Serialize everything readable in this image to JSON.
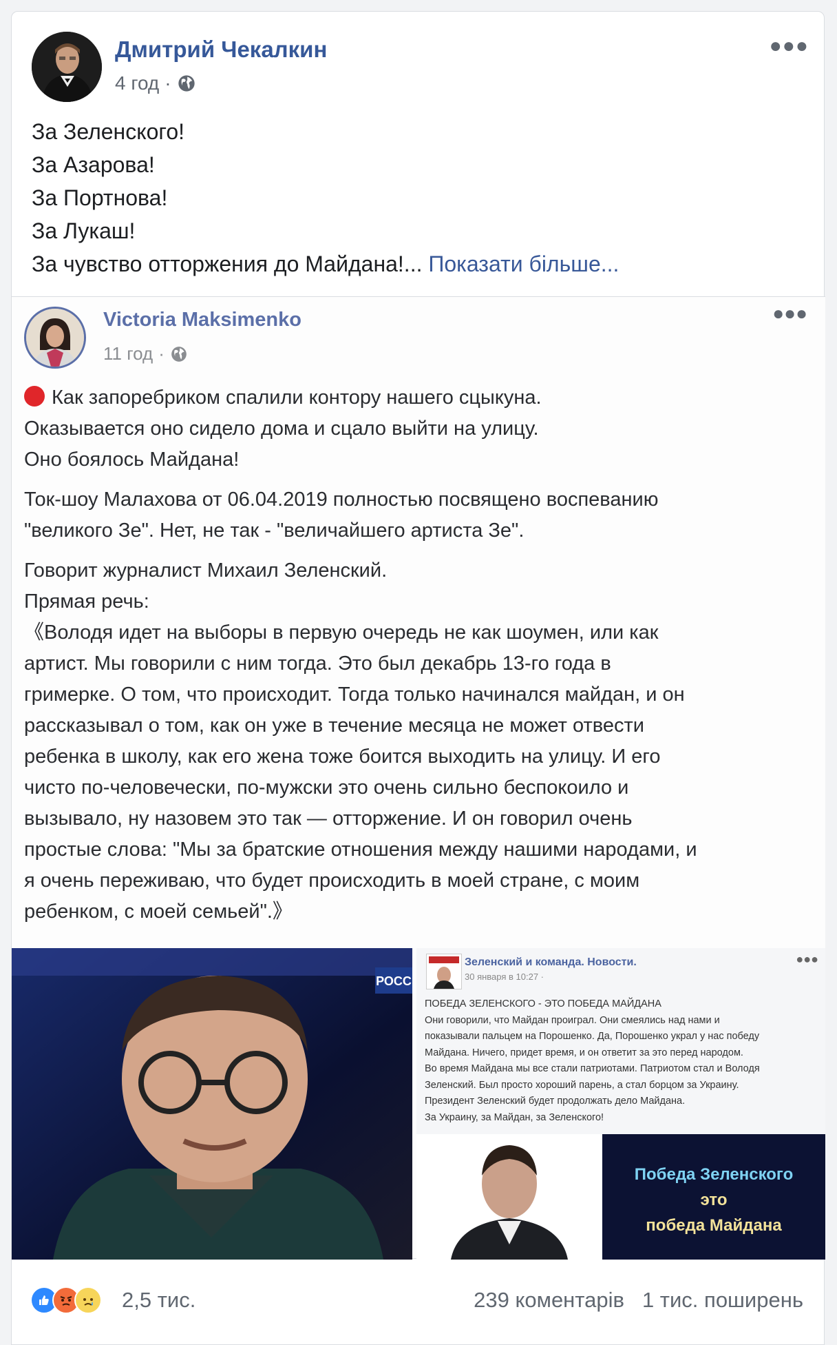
{
  "post": {
    "author": "Дмитрий Чекалкин",
    "time": "4 год",
    "separator": "·",
    "lines": [
      "За Зеленского!",
      "За Азарова!",
      "За Портнова!",
      "За Лукаш!",
      "За чувство отторжения до Майдана!..."
    ],
    "see_more": "Показати більше..."
  },
  "shared": {
    "author": "Victoria Maksimenko",
    "time": "11 год",
    "separator": "·",
    "p1": [
      "Как запоребриком спалили контору нашего сцыкуна.",
      "Оказывается оно сидело дома и сцало выйти на улицу.",
      "Оно боялось Майдана!"
    ],
    "p2": [
      "Ток-шоу Малахова от 06.04.2019 полностью посвящено воспеванию",
      "\"великого Зе\". Нет, не так - \"величайшего артиста Зе\"."
    ],
    "p3": [
      "Говорит журналист Михаил Зеленский.",
      "Прямая речь:",
      "《Володя идет на выборы в первую очередь не как шоумен, или как",
      "артист. Мы говорили с ним тогда. Это был декабрь 13-го года в",
      "гримерке. О том, что происходит. Тогда только начинался майдан, и он",
      "рассказывал о том, как он уже в течение месяца не может отвести",
      "ребенка в школу, как его жена тоже боится выходить на улицу. И его",
      "чисто по-человечески, по-мужски это очень сильно беспокоило и",
      "вызывало, ну назовем это так — отторжение. И он говорил очень",
      "простые слова: \"Мы за братские отношения между нашими народами, и",
      "я очень переживаю, что будет происходить в моей стране, с моим",
      "ребенком, с моей семьей\".》"
    ],
    "image_left": {
      "tv_logo": "РОСС"
    },
    "image_right": {
      "page_name": "Зеленский и команда. Новости.",
      "date": "30 января в 10:27 ·",
      "lines": [
        "ПОБЕДА ЗЕЛЕНСКОГО - ЭТО ПОБЕДА МАЙДАНА",
        "Они говорили, что Майдан проиграл. Они смеялись над нами и",
        "показывали пальцем на Порошенко. Да, Порошенко украл у нас победу",
        "Майдана. Ничего, придет время, и он ответит за это перед народом.",
        "Во время Майдана мы все стали патриотами. Патриотом стал и Володя",
        "Зеленский. Был просто хороший парень, а стал борцом за Украину.",
        "Президент Зеленский будет продолжать дело Майдана.",
        "За Украину, за Майдан, за Зеленского!"
      ],
      "banner": [
        "Победа Зеленского",
        "это",
        "победа Майдана"
      ]
    }
  },
  "footer": {
    "reactions_count": "2,5 тис.",
    "comments": "239 коментарів",
    "shares": "1 тис. поширень"
  },
  "colors": {
    "link": "#365899",
    "muted": "#606770",
    "like_blue": "#2e89ff"
  },
  "icons": [
    "globe-icon",
    "more-icon",
    "like-reaction-icon",
    "angry-reaction-icon",
    "sad-reaction-icon"
  ]
}
